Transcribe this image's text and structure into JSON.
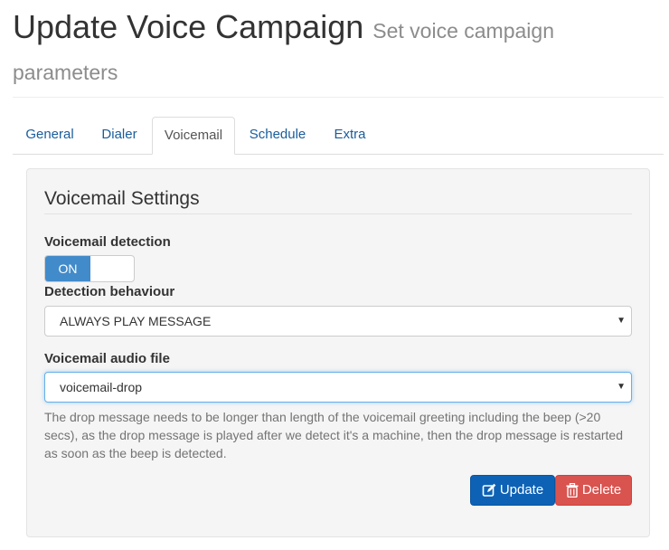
{
  "header": {
    "title": "Update Voice Campaign",
    "subtitle": "Set voice campaign parameters"
  },
  "tabs": [
    {
      "label": "General",
      "active": false
    },
    {
      "label": "Dialer",
      "active": false
    },
    {
      "label": "Voicemail",
      "active": true
    },
    {
      "label": "Schedule",
      "active": false
    },
    {
      "label": "Extra",
      "active": false
    }
  ],
  "panel": {
    "title": "Voicemail Settings",
    "detection": {
      "label": "Voicemail detection",
      "toggle_on_label": "ON",
      "enabled": true
    },
    "behaviour": {
      "label": "Detection behaviour",
      "value": "ALWAYS PLAY MESSAGE"
    },
    "audio_file": {
      "label": "Voicemail audio file",
      "value": "voicemail-drop",
      "help": "The drop message needs to be longer than length of the voicemail greeting including the beep (>20 secs), as the drop message is played after we detect it's a machine, then the drop message is restarted as soon as the beep is detected."
    },
    "buttons": {
      "update_label": "Update",
      "update_icon": "edit-icon",
      "delete_label": "Delete",
      "delete_icon": "trash-icon"
    }
  },
  "colors": {
    "primary": "#0d62b6",
    "danger": "#d9534f",
    "toggle_on": "#428bca",
    "tab_link": "#1a5d9c"
  }
}
